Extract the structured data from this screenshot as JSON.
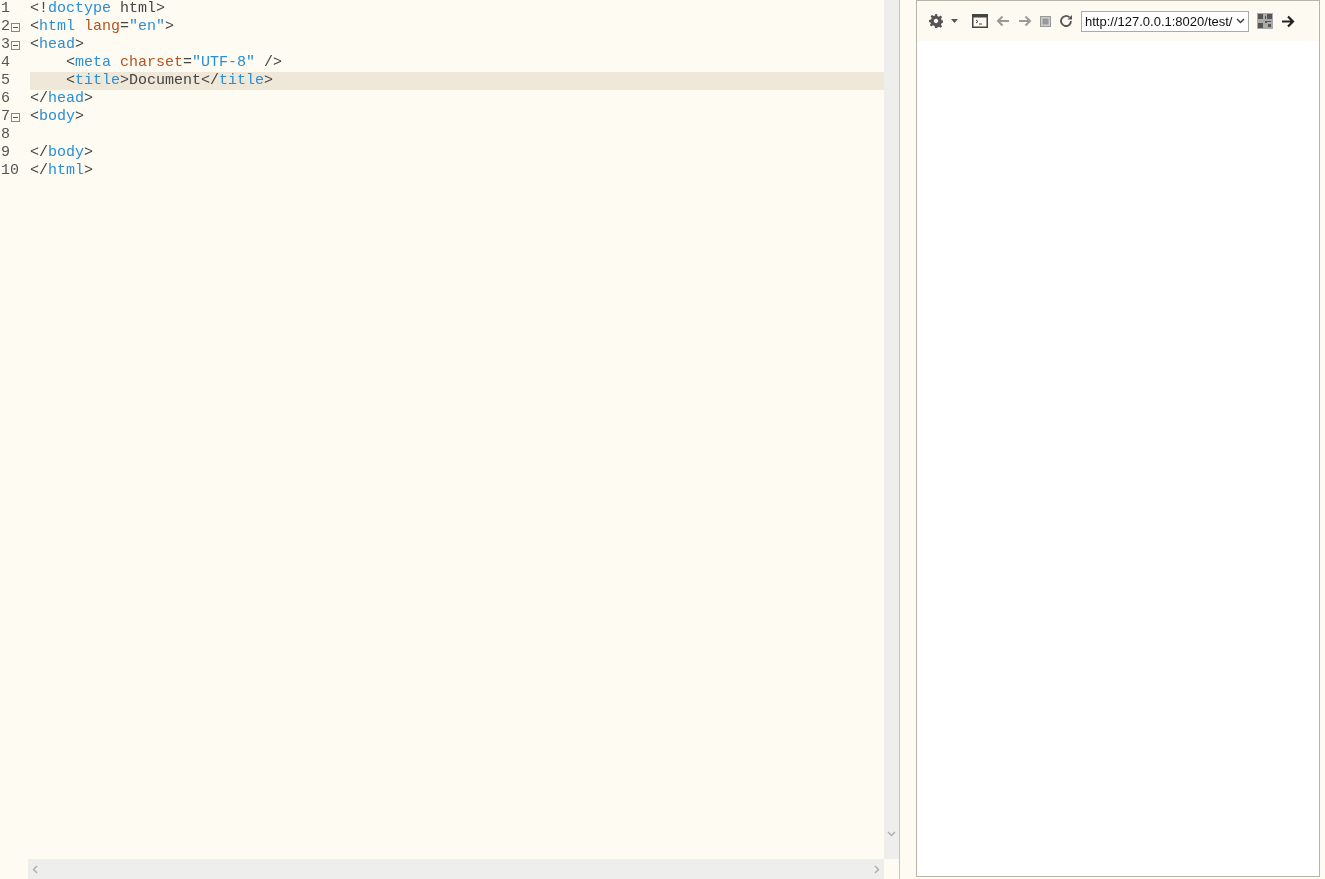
{
  "editor": {
    "lines": [
      {
        "number": "1",
        "foldable": false,
        "current": false,
        "tokens": [
          {
            "kind": "punct",
            "text": "<!"
          },
          {
            "kind": "tag",
            "text": "doctype"
          },
          {
            "kind": "punct",
            "text": " html>"
          }
        ]
      },
      {
        "number": "2",
        "foldable": true,
        "current": false,
        "tokens": [
          {
            "kind": "punct",
            "text": "<"
          },
          {
            "kind": "tag",
            "text": "html"
          },
          {
            "kind": "attr",
            "text": " lang"
          },
          {
            "kind": "punct",
            "text": "="
          },
          {
            "kind": "string",
            "text": "\"en\""
          },
          {
            "kind": "punct",
            "text": ">"
          }
        ]
      },
      {
        "number": "3",
        "foldable": true,
        "current": false,
        "tokens": [
          {
            "kind": "punct",
            "text": "<"
          },
          {
            "kind": "tag",
            "text": "head"
          },
          {
            "kind": "punct",
            "text": ">"
          }
        ]
      },
      {
        "number": "4",
        "foldable": false,
        "current": false,
        "tokens": [
          {
            "kind": "punct",
            "text": "    <"
          },
          {
            "kind": "tag",
            "text": "meta"
          },
          {
            "kind": "attr",
            "text": " charset"
          },
          {
            "kind": "punct",
            "text": "="
          },
          {
            "kind": "string",
            "text": "\"UTF-8\""
          },
          {
            "kind": "punct",
            "text": " />"
          }
        ]
      },
      {
        "number": "5",
        "foldable": false,
        "current": true,
        "tokens": [
          {
            "kind": "punct",
            "text": "    <"
          },
          {
            "kind": "tag",
            "text": "title"
          },
          {
            "kind": "punct",
            "text": ">Document</"
          },
          {
            "kind": "tag",
            "text": "title"
          },
          {
            "kind": "punct",
            "text": ">"
          }
        ]
      },
      {
        "number": "6",
        "foldable": false,
        "current": false,
        "tokens": [
          {
            "kind": "punct",
            "text": "</"
          },
          {
            "kind": "tag",
            "text": "head"
          },
          {
            "kind": "punct",
            "text": ">"
          }
        ]
      },
      {
        "number": "7",
        "foldable": true,
        "current": false,
        "tokens": [
          {
            "kind": "punct",
            "text": "<"
          },
          {
            "kind": "tag",
            "text": "body"
          },
          {
            "kind": "punct",
            "text": ">"
          }
        ]
      },
      {
        "number": "8",
        "foldable": false,
        "current": false
      },
      {
        "number": "9",
        "foldable": false,
        "current": false,
        "tokens": [
          {
            "kind": "punct",
            "text": "</"
          },
          {
            "kind": "tag",
            "text": "body"
          },
          {
            "kind": "punct",
            "text": ">"
          }
        ]
      },
      {
        "number": "10",
        "foldable": false,
        "current": false,
        "tokens": [
          {
            "kind": "punct",
            "text": "</"
          },
          {
            "kind": "tag",
            "text": "html"
          },
          {
            "kind": "punct",
            "text": ">"
          }
        ]
      }
    ]
  },
  "preview": {
    "url": "http://127.0.0.1:8020/test/"
  }
}
